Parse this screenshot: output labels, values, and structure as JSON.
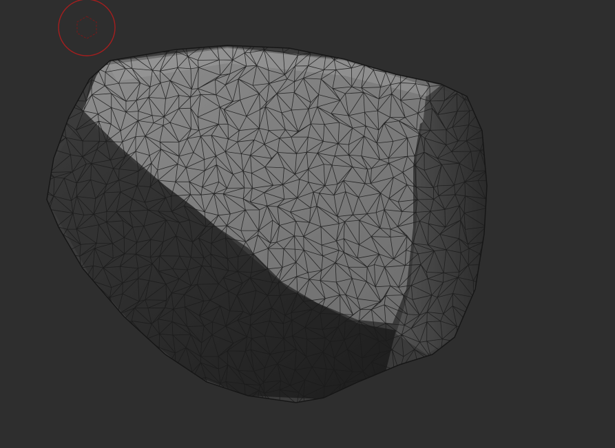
{
  "viewport": {
    "background_color": "#2e2e2e",
    "mesh_light_color": "#7c7c7c",
    "mesh_mid_color": "#5a5a5a",
    "mesh_dark_color": "#262626",
    "wire_color": "#1b1b1b",
    "brush_cursor_color": "#a61e1e",
    "brush_cursor_icon": "brush-cursor-icon",
    "view_mode": "wireframe-on-shaded",
    "object": "rock-mesh"
  }
}
